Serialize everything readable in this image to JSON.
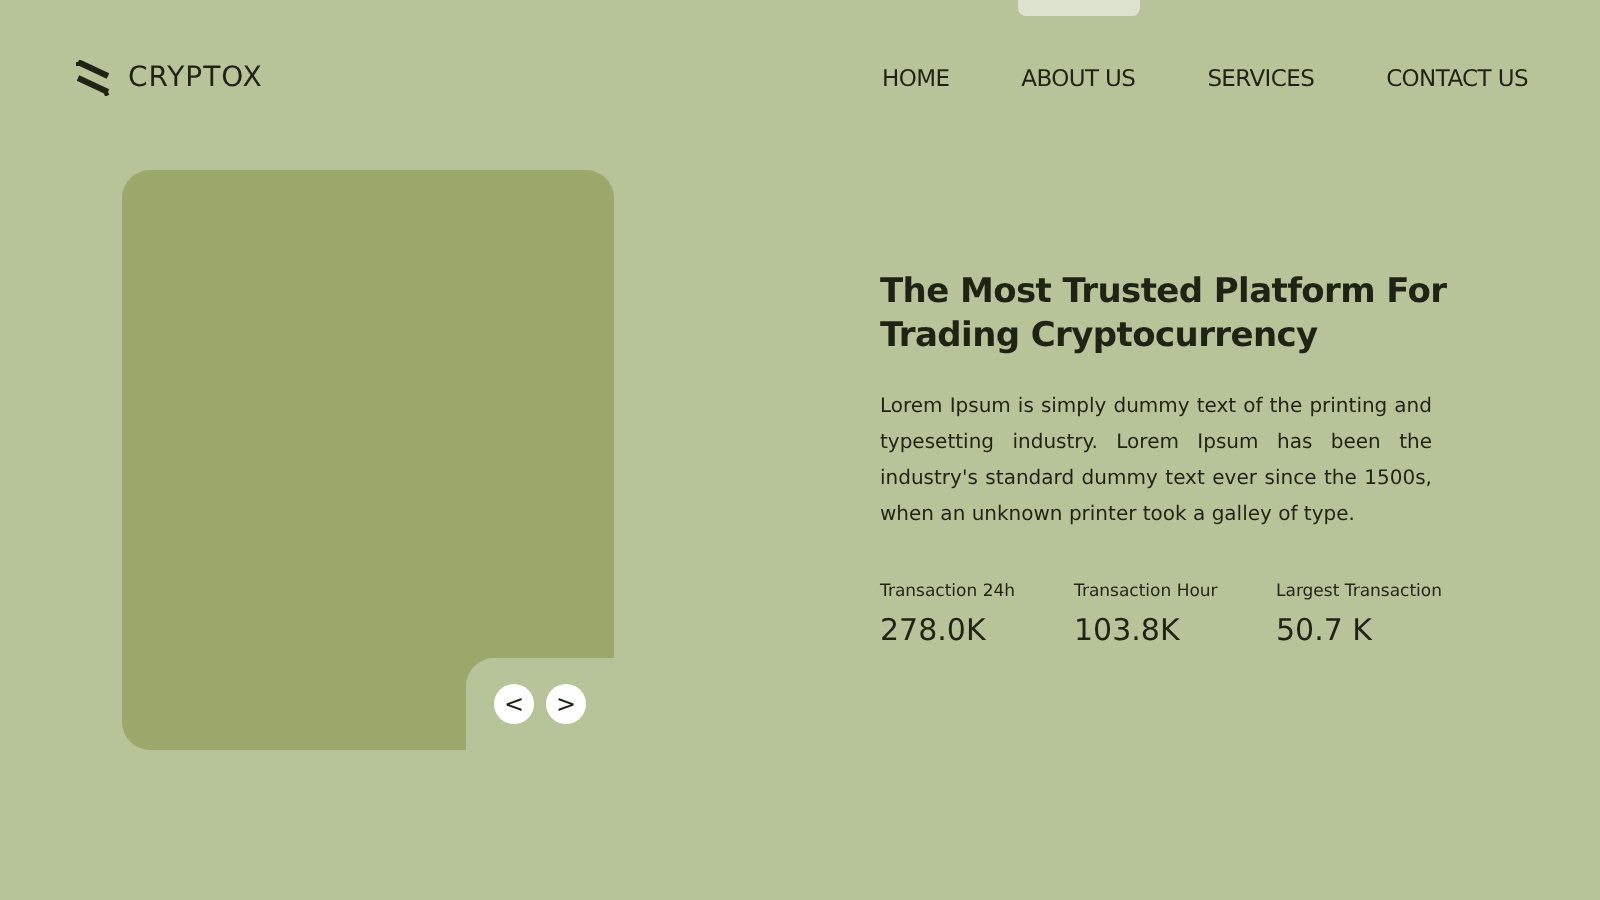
{
  "brand": {
    "name": "CRYPTOX"
  },
  "nav": [
    {
      "label": "HOME"
    },
    {
      "label": "ABOUT US"
    },
    {
      "label": "SERVICES"
    },
    {
      "label": "CONTACT US"
    }
  ],
  "hero": {
    "title": "The Most Trusted Platform For Trading Cryptocurrency",
    "body": "Lorem Ipsum is simply dummy text of the printing and typesetting industry.  Lorem Ipsum has been the industry's standard dummy text ever since the 1500s,  when an unknown printer took a galley of type.",
    "prev": "<",
    "next": ">",
    "stats": [
      {
        "label": "Transaction 24h",
        "value": "278.0K"
      },
      {
        "label": "Transaction Hour",
        "value": "103.8K"
      },
      {
        "label": "Largest Transaction",
        "value": "50.7 K"
      }
    ]
  }
}
